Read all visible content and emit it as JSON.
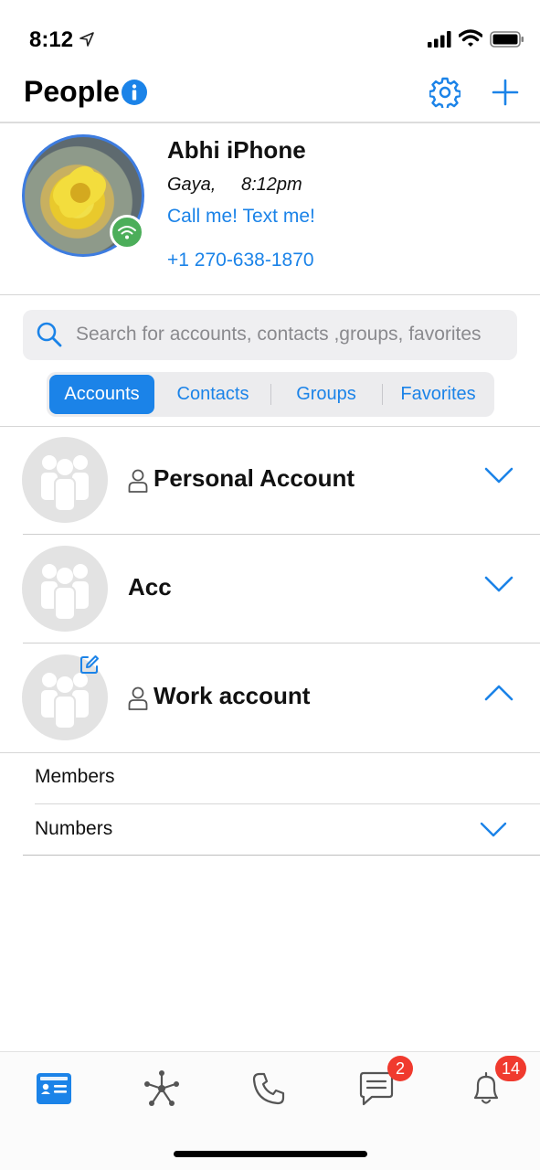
{
  "status_bar": {
    "time": "8:12"
  },
  "header": {
    "title": "People"
  },
  "profile": {
    "name": "Abhi iPhone",
    "location": "Gaya,",
    "local_time": "8:12pm",
    "status_message": "Call me! Text me!",
    "phone": "+1 270-638-1870"
  },
  "search": {
    "placeholder": "Search for accounts, contacts ,groups, favorites"
  },
  "segments": [
    {
      "label": "Accounts",
      "active": true
    },
    {
      "label": "Contacts",
      "active": false
    },
    {
      "label": "Groups",
      "active": false
    },
    {
      "label": "Favorites",
      "active": false
    }
  ],
  "accounts": [
    {
      "name": "Personal Account",
      "has_person_icon": true,
      "expanded": false
    },
    {
      "name": "Acc",
      "has_person_icon": false,
      "expanded": false
    },
    {
      "name": "Work account",
      "has_person_icon": true,
      "expanded": true,
      "editable": true
    }
  ],
  "work_account_sections": [
    {
      "label": "Members"
    },
    {
      "label": "Numbers"
    }
  ],
  "tab_bar": {
    "tabs": [
      {
        "icon": "contact-card-icon",
        "active": true
      },
      {
        "icon": "hub-icon",
        "active": false
      },
      {
        "icon": "phone-icon",
        "active": false
      },
      {
        "icon": "message-icon",
        "active": false,
        "badge": "2"
      },
      {
        "icon": "bell-icon",
        "active": false,
        "badge": "14"
      }
    ]
  },
  "colors": {
    "accent": "#1b83e8",
    "online": "#4cae5a",
    "badge": "#f03a2e"
  }
}
